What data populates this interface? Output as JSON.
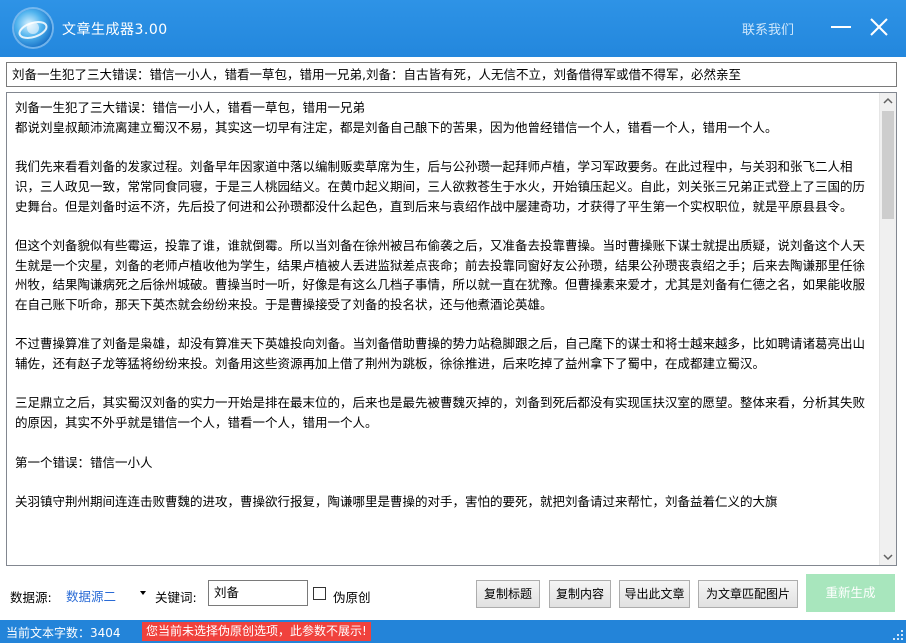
{
  "window": {
    "title": "文章生成器3.00",
    "contact_link": "联系我们"
  },
  "article_title": "刘备一生犯了三大错误：错信一小人，错看一草包，错用一兄弟,刘备：自古皆有死，人无信不立，刘备借得军或借不得军，必然亲至",
  "article": {
    "paragraphs": [
      "刘备一生犯了三大错误：错信一小人，错看一草包，错用一兄弟\n都说刘皇叔颠沛流离建立蜀汉不易，其实这一切早有注定，都是刘备自己酿下的苦果，因为他曾经错信一个人，错看一个人，错用一个人。",
      "我们先来看看刘备的发家过程。刘备早年因家道中落以编制贩卖草席为生，后与公孙瓒一起拜师卢植，学习军政要务。在此过程中，与关羽和张飞二人相识，三人政见一致，常常同食同寝，于是三人桃园结义。在黄巾起义期间，三人欲救苍生于水火，开始镇压起义。自此，刘关张三兄弟正式登上了三国的历史舞台。但是刘备时运不济，先后投了何进和公孙瓒都没什么起色，直到后来与袁绍作战中屡建奇功，才获得了平生第一个实权职位，就是平原县县令。",
      "但这个刘备貌似有些霉运，投靠了谁，谁就倒霉。所以当刘备在徐州被吕布偷袭之后，又准备去投靠曹操。当时曹操账下谋士就提出质疑，说刘备这个人天生就是一个灾星，刘备的老师卢植收他为学生，结果卢植被人丢进监狱差点丧命；前去投靠同窗好友公孙瓒，结果公孙瓒丧袁绍之手；后来去陶谦那里任徐州牧，结果陶谦病死之后徐州城破。曹操当时一听，好像是有这么几档子事情，所以就一直在犹豫。但曹操素来爱才，尤其是刘备有仁德之名，如果能收服在自己账下听命，那天下英杰就会纷纷来投。于是曹操接受了刘备的投名状，还与他煮酒论英雄。",
      "不过曹操算准了刘备是枭雄，却没有算准天下英雄投向刘备。当刘备借助曹操的势力站稳脚跟之后，自己麾下的谋士和将士越来越多，比如聘请诸葛亮出山辅佐，还有赵子龙等猛将纷纷来投。刘备用这些资源再加上借了荆州为跳板，徐徐推进，后来吃掉了益州拿下了蜀中，在成都建立蜀汉。",
      "三足鼎立之后，其实蜀汉刘备的实力一开始是排在最末位的，后来也是最先被曹魏灭掉的，刘备到死后都没有实现匡扶汉室的愿望。整体来看，分析其失败的原因，其实不外乎就是错信一个人，错看一个人，错用一个人。",
      "第一个错误：错信一小人",
      "关羽镇守荆州期间连连击败曹魏的进攻，曹操欲行报复，陶谦哪里是曹操的对手，害怕的要死，就把刘备请过来帮忙，刘备益着仁义的大旗"
    ]
  },
  "controls": {
    "data_source_label": "数据源:",
    "data_source_value": "数据源二",
    "keyword_label": "关键词:",
    "keyword_value": "刘备",
    "pseudo_original_label": "伪原创",
    "pseudo_original_checked": false,
    "copy_title_btn": "复制标题",
    "copy_content_btn": "复制内容",
    "export_btn": "导出此文章",
    "match_image_btn": "为文章匹配图片",
    "regenerate_btn": "重新生成"
  },
  "status": {
    "word_count": "当前文本字数：3404",
    "warning": "您当前未选择伪原创选项，此参数不展示!"
  },
  "colors": {
    "titlebar": "#2387dd",
    "statusbar": "#2384d9",
    "warning_bg": "#f0423d",
    "regenerate_bg": "#a8e6bd",
    "select_text": "#2a6bd6"
  }
}
